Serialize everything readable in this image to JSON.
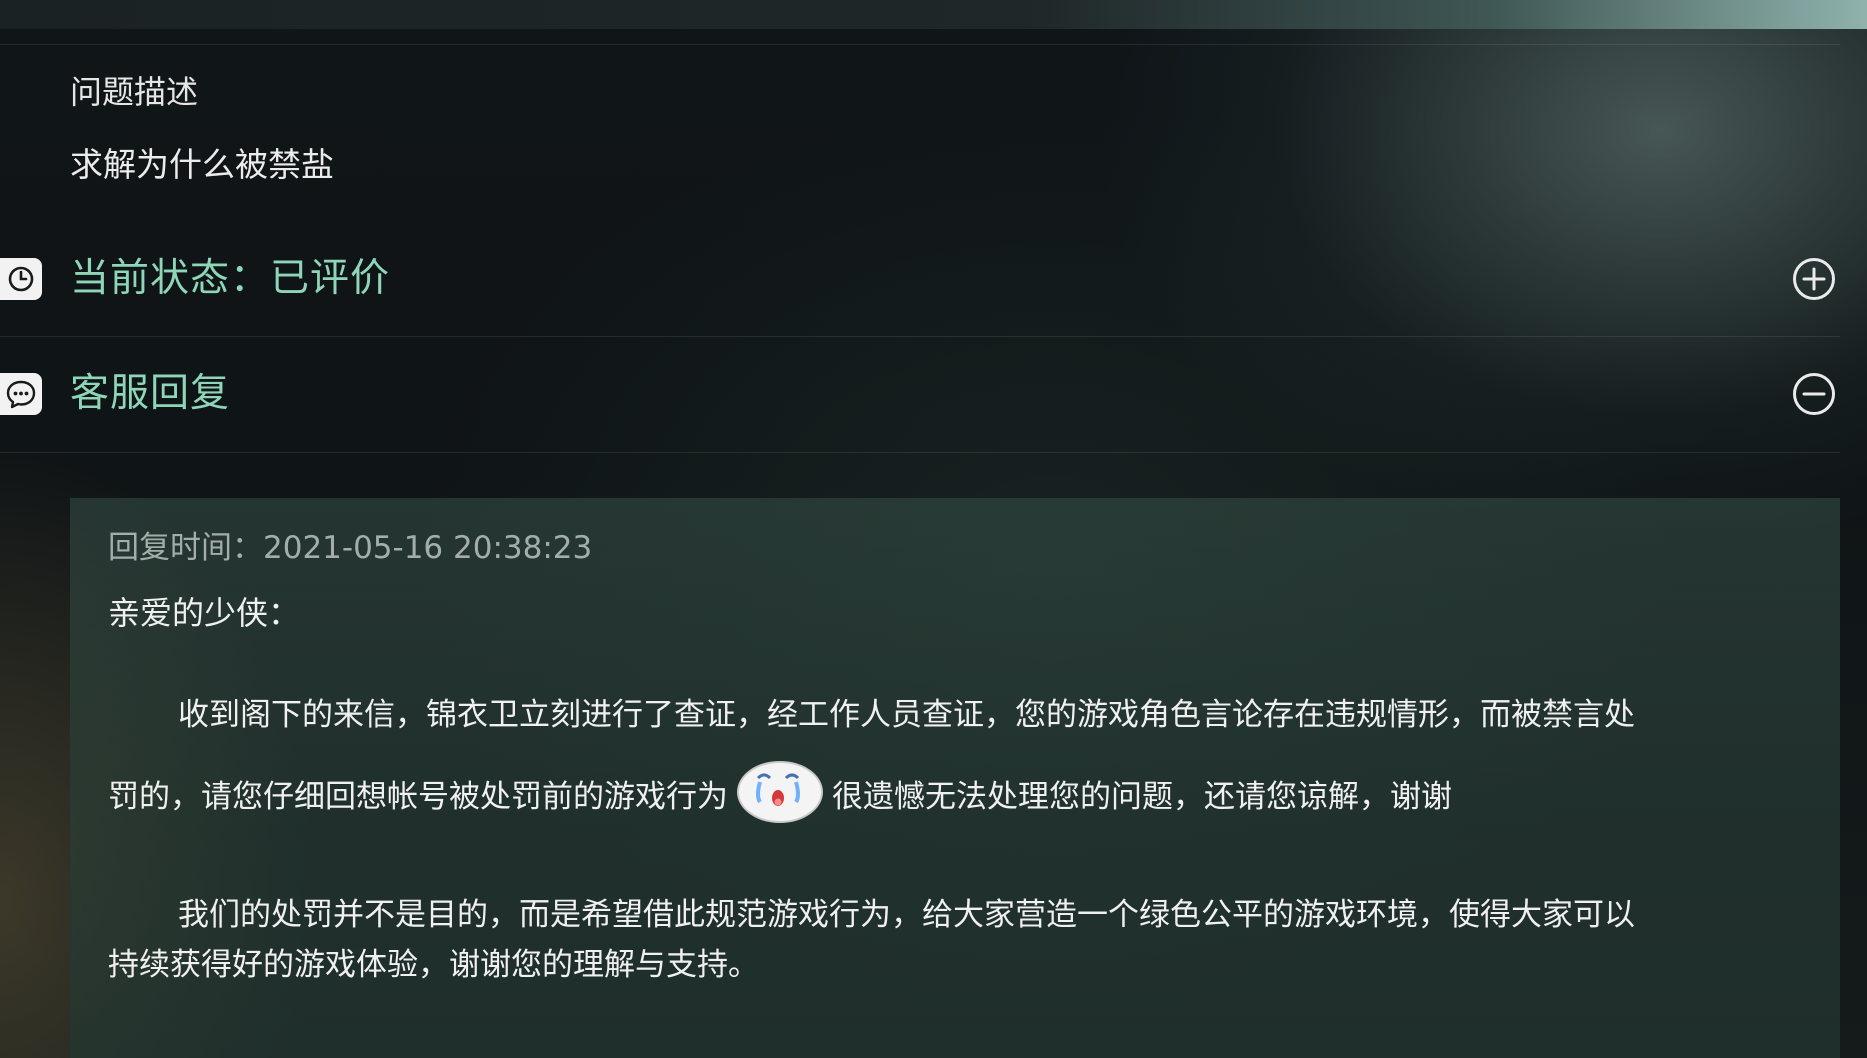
{
  "description": {
    "label": "问题描述",
    "text": "求解为什么被禁盐"
  },
  "status": {
    "icon": "clock-icon",
    "title": "当前状态：已评价",
    "toggle_icon": "plus-circle-icon"
  },
  "service_reply": {
    "icon": "chat-bubble-icon",
    "title": "客服回复",
    "toggle_icon": "minus-circle-icon",
    "reply_time": "回复时间：2021-05-16 20:38:23",
    "greeting": "亲爱的少侠：",
    "para1_line1": "收到阁下的来信，锦衣卫立刻进行了查证，经工作人员查证，您的游戏角色言论存在违规情形，而被禁言处",
    "para1_line2_a": "罚的，请您仔细回想帐号被处罚前的游戏行为",
    "emoji": "crying-face-emoji",
    "para1_line2_b": "很遗憾无法处理您的问题，还请您谅解，谢谢",
    "para2_line1": "我们的处罚并不是目的，而是希望借此规范游戏行为，给大家营造一个绿色公平的游戏环境，使得大家可以",
    "para2_line2": "持续获得好的游戏体验，谢谢您的理解与支持。"
  },
  "colors": {
    "accent": "#8fd6b8",
    "text": "#f0f0f0",
    "muted": "#a3aeaa"
  }
}
